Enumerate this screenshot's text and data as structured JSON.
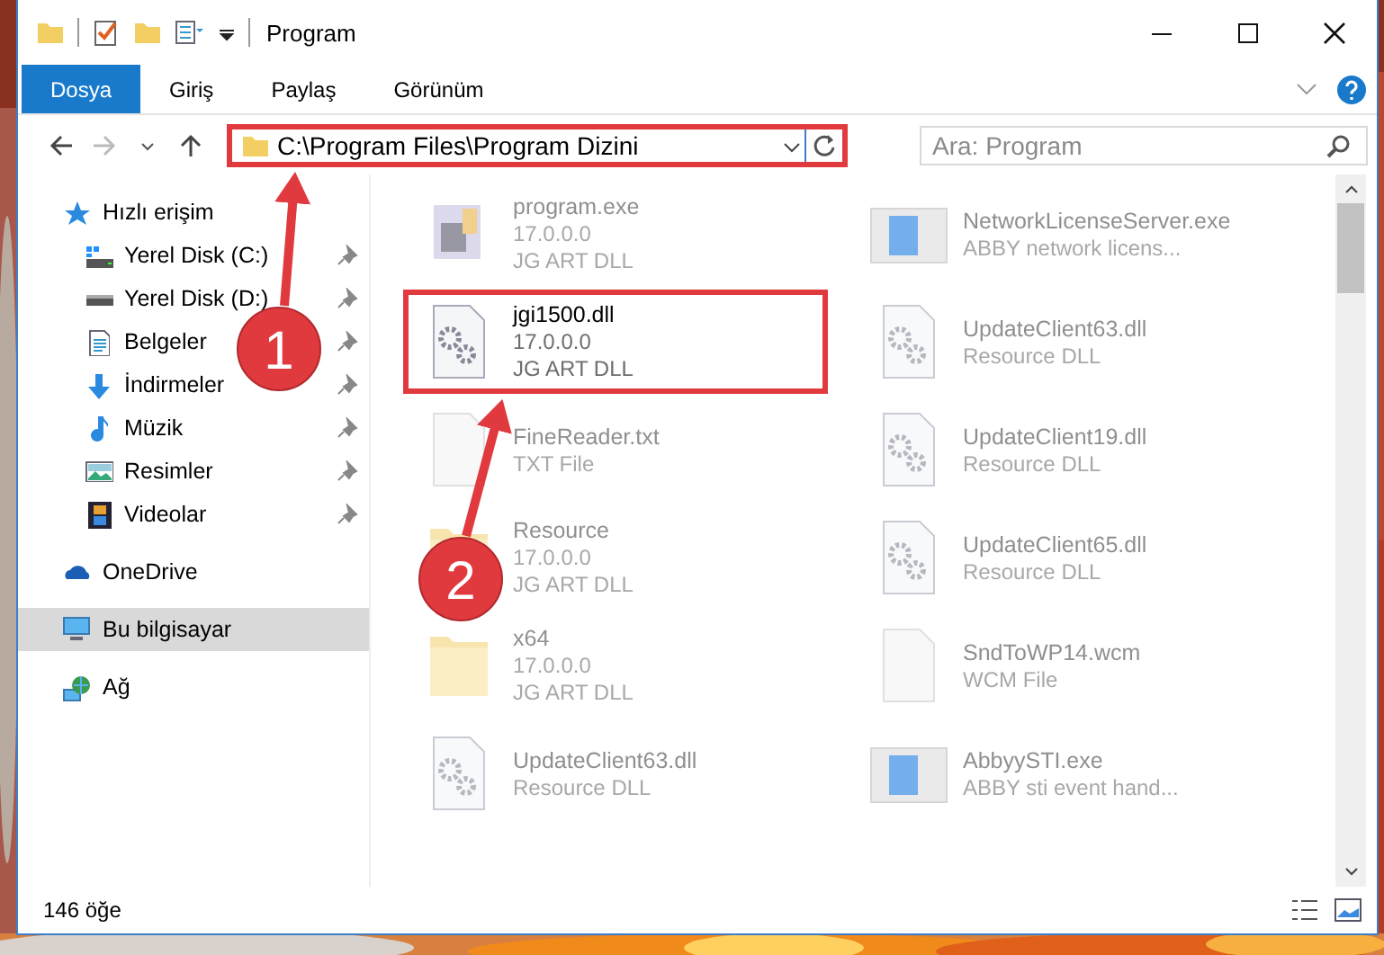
{
  "window": {
    "title": "Program"
  },
  "ribbon_tabs": [
    {
      "label": "Dosya",
      "selected": true
    },
    {
      "label": "Giriş",
      "selected": false
    },
    {
      "label": "Paylaş",
      "selected": false
    },
    {
      "label": "Görünüm",
      "selected": false
    }
  ],
  "address_bar": {
    "path": "C:\\Program Files\\Program Dizini",
    "highlighted": true
  },
  "search": {
    "placeholder": "Ara: Program"
  },
  "sidebar": {
    "items": [
      {
        "label": "Hızlı erişim",
        "selected": false,
        "children": [
          {
            "label": "Yerel Disk (C:)",
            "pinned": true,
            "selected": false
          },
          {
            "label": "Yerel Disk (D:)",
            "pinned": true,
            "selected": false
          },
          {
            "label": "Belgeler",
            "pinned": true,
            "selected": false
          },
          {
            "label": "İndirmeler",
            "pinned": true,
            "selected": false
          },
          {
            "label": "Müzik",
            "pinned": true,
            "selected": false
          },
          {
            "label": "Resimler",
            "pinned": true,
            "selected": false
          },
          {
            "label": "Videolar",
            "pinned": true,
            "selected": false
          }
        ]
      },
      {
        "label": "OneDrive",
        "selected": false
      },
      {
        "label": "Bu bilgisayar",
        "selected": true
      },
      {
        "label": "Ağ",
        "selected": false
      }
    ]
  },
  "files": [
    {
      "name": "program.exe",
      "details": [
        "17.0.0.0",
        "JG ART DLL"
      ],
      "kind": "program",
      "blurred": true,
      "highlighted": false
    },
    {
      "name": "NetworkLicenseServer.exe",
      "details": [
        "ABBY network licens..."
      ],
      "kind": "application",
      "blurred": true,
      "highlighted": false
    },
    {
      "name": "jgi1500.dll",
      "details": [
        "17.0.0.0",
        "JG ART DLL"
      ],
      "kind": "dll",
      "blurred": false,
      "highlighted": true
    },
    {
      "name": "UpdateClient63.dll",
      "details": [
        "Resource DLL"
      ],
      "kind": "dll",
      "blurred": true,
      "highlighted": false
    },
    {
      "name": "FineReader.txt",
      "details": [
        "TXT File"
      ],
      "kind": "file",
      "blurred": true,
      "highlighted": false
    },
    {
      "name": "UpdateClient19.dll",
      "details": [
        "Resource DLL"
      ],
      "kind": "dll",
      "blurred": true,
      "highlighted": false
    },
    {
      "name": "Resource",
      "details": [
        "17.0.0.0",
        "JG ART DLL"
      ],
      "kind": "folder",
      "blurred": true,
      "highlighted": false
    },
    {
      "name": "UpdateClient65.dll",
      "details": [
        "Resource DLL"
      ],
      "kind": "dll",
      "blurred": true,
      "highlighted": false
    },
    {
      "name": "x64",
      "details": [
        "17.0.0.0",
        "JG ART DLL"
      ],
      "kind": "folder",
      "blurred": true,
      "highlighted": false
    },
    {
      "name": "SndToWP14.wcm",
      "details": [
        "WCM File"
      ],
      "kind": "file",
      "blurred": true,
      "highlighted": false
    },
    {
      "name": "UpdateClient63.dll",
      "details": [
        "Resource DLL"
      ],
      "kind": "dll",
      "blurred": true,
      "highlighted": false
    },
    {
      "name": "AbbyySTI.exe",
      "details": [
        "ABBY sti event hand..."
      ],
      "kind": "application",
      "blurred": true,
      "highlighted": false
    }
  ],
  "status_bar": {
    "item_count": "146 öğe"
  },
  "callouts": [
    {
      "number": "1"
    },
    {
      "number": "2"
    }
  ]
}
